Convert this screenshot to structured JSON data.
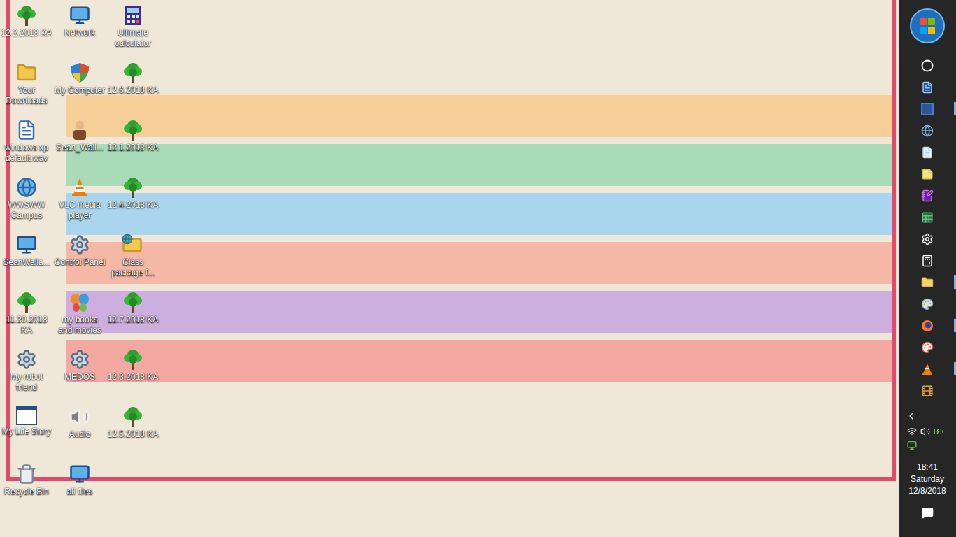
{
  "desktop_icons": [
    {
      "label": "12.2.2018 KA",
      "kind": "tree"
    },
    {
      "label": "Your Downloads",
      "kind": "downloads"
    },
    {
      "label": "windows xp default.wav",
      "kind": "audio-file"
    },
    {
      "label": "WWSWW Campus",
      "kind": "globe"
    },
    {
      "label": "SeanWalla...",
      "kind": "computer"
    },
    {
      "label": "11.30.2018 KA",
      "kind": "tree"
    },
    {
      "label": "My robot friend",
      "kind": "gears"
    },
    {
      "label": "My Life Story",
      "kind": "app-window"
    },
    {
      "label": "Recycle Bin",
      "kind": "recycle"
    },
    {
      "label": "Network",
      "kind": "network"
    },
    {
      "label": "My Computer",
      "kind": "shield"
    },
    {
      "label": "Sean_Wall...",
      "kind": "person"
    },
    {
      "label": "VLC media player",
      "kind": "vlc"
    },
    {
      "label": "Control Panel",
      "kind": "control-panel"
    },
    {
      "label": "my books and movies",
      "kind": "butterfly"
    },
    {
      "label": "MEDOS",
      "kind": "disc"
    },
    {
      "label": "Audio",
      "kind": "speaker"
    },
    {
      "label": "all files",
      "kind": "monitor"
    },
    {
      "label": "Ultimate calculator",
      "kind": "calculator"
    },
    {
      "label": "12.6.2018 KA",
      "kind": "tree"
    },
    {
      "label": "12.1.2018 KA",
      "kind": "tree"
    },
    {
      "label": "12.4.2018 KA",
      "kind": "tree"
    },
    {
      "label": "Class package f...",
      "kind": "folder-globe"
    },
    {
      "label": "12.7.2018 KA",
      "kind": "tree"
    },
    {
      "label": "12.3.2018 KA",
      "kind": "tree"
    },
    {
      "label": "12.5.2018 KA",
      "kind": "tree"
    }
  ],
  "taskbar": {
    "pinned": [
      {
        "kind": "cortana",
        "running": false
      },
      {
        "kind": "document",
        "running": false
      },
      {
        "kind": "word",
        "running": true
      },
      {
        "kind": "browser",
        "running": false
      },
      {
        "kind": "notepad",
        "running": false
      },
      {
        "kind": "sticky",
        "running": false
      },
      {
        "kind": "onenote",
        "running": false
      },
      {
        "kind": "sheet",
        "running": false
      },
      {
        "kind": "settings",
        "running": false
      },
      {
        "kind": "calculator",
        "running": false
      },
      {
        "kind": "folder",
        "running": true
      },
      {
        "kind": "paint",
        "running": false
      },
      {
        "kind": "firefox",
        "running": true
      },
      {
        "kind": "paint2",
        "running": false
      },
      {
        "kind": "vlc",
        "running": true
      },
      {
        "kind": "film",
        "running": false
      }
    ],
    "clock": {
      "time": "18:41",
      "day": "Saturday",
      "date": "12/8/2018"
    }
  }
}
